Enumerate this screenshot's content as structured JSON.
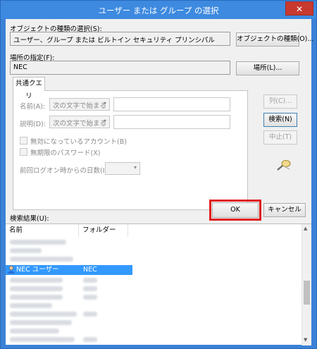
{
  "window": {
    "title": "ユーザー または グループ の選択",
    "close_glyph": "✕"
  },
  "object_type": {
    "label": "オブジェクトの種類の選択(S):",
    "value": "ユーザー、グループ または ビルトイン セキュリティ プリンシパル",
    "button": "オブジェクトの種類(O)..."
  },
  "location": {
    "label": "場所の指定(F):",
    "value": "NEC",
    "button": "場所(L)..."
  },
  "query": {
    "tab": "共通クエリ",
    "name_label": "名前(A):",
    "name_combo": "次の文字で始まる",
    "desc_label": "説明(D):",
    "desc_combo": "次の文字で始まる",
    "check_disabled": "無効になっているアカウント(B)",
    "check_noexpire": "無期限のパスワード(X)",
    "days_label": "前回ログオン時からの日数(I):"
  },
  "side_buttons": {
    "columns": "列(C)...",
    "search": "検索(N)",
    "stop": "中止(T)"
  },
  "search_icon": "magnifier-icon",
  "ok_button": "OK",
  "cancel_button": "キャンセル",
  "results": {
    "label": "検索結果(U):",
    "col_name": "名前",
    "col_folder": "フォルダー",
    "selected_row": {
      "name": "NEC ユーザー",
      "folder": "NEC"
    }
  },
  "colors": {
    "title_bar": "#3d8ae0",
    "close": "#c8392f",
    "selection": "#3399ff",
    "highlight": "#e01b1b"
  }
}
